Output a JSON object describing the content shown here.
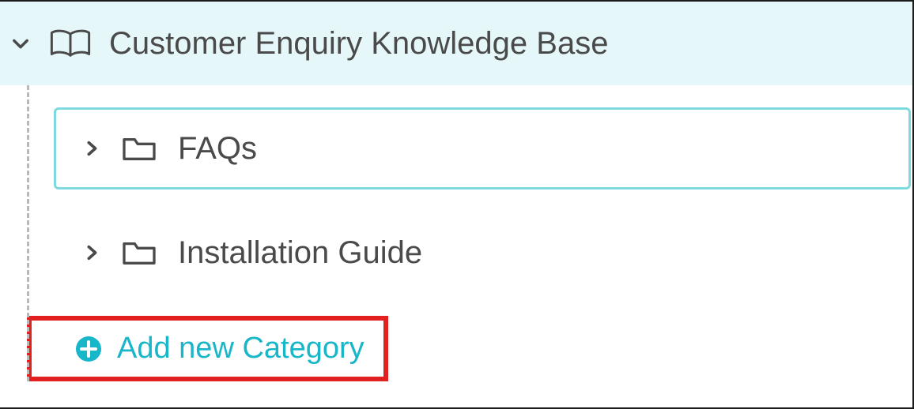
{
  "root": {
    "label": "Customer Enquiry Knowledge Base"
  },
  "categories": [
    {
      "label": "FAQs",
      "selected": true
    },
    {
      "label": "Installation Guide",
      "selected": false
    }
  ],
  "actions": {
    "add_category_label": "Add new Category"
  },
  "colors": {
    "accent": "#18b6c9",
    "selected_border": "#7fd9e0",
    "root_bg": "#e6f7f9",
    "highlight_border": "#e1201f"
  }
}
